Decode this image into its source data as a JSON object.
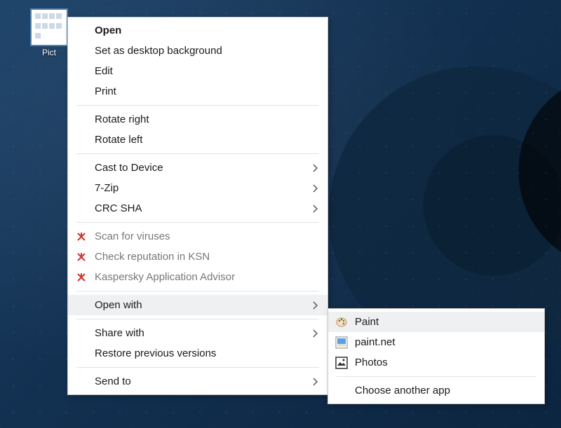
{
  "desktop_icon": {
    "label": "Pict"
  },
  "context_menu": {
    "open": "Open",
    "set_bg": "Set as desktop background",
    "edit": "Edit",
    "print": "Print",
    "rotate_right": "Rotate right",
    "rotate_left": "Rotate left",
    "cast": "Cast to Device",
    "sevenzip": "7-Zip",
    "crc": "CRC SHA",
    "scan": "Scan for viruses",
    "ksn": "Check reputation in KSN",
    "kadvisor": "Kaspersky Application Advisor",
    "open_with": "Open with",
    "share_with": "Share with",
    "restore": "Restore previous versions",
    "send_to": "Send to"
  },
  "open_with_menu": {
    "paint": "Paint",
    "paintnet": "paint.net",
    "photos": "Photos",
    "choose": "Choose another app"
  }
}
